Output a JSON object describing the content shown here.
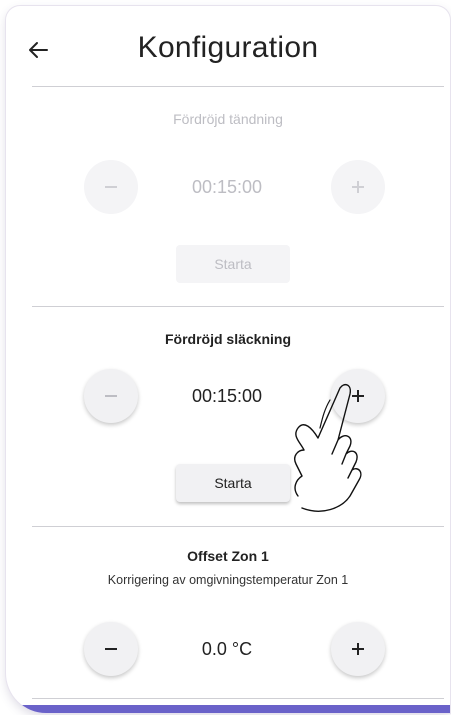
{
  "header": {
    "title": "Konfiguration",
    "back_icon": "arrow-left-icon"
  },
  "sections": [
    {
      "title": "Fördröjd tändning",
      "subtitle": "",
      "value": "00:15:00",
      "start_label": "Starta",
      "state": "disabled"
    },
    {
      "title": "Fördröjd släckning",
      "subtitle": "",
      "value": "00:15:00",
      "start_label": "Starta",
      "state": "enabled"
    },
    {
      "title": "Offset Zon 1",
      "subtitle": "Korrigering av omgivningstemperatur Zon 1",
      "value": "0.0 °C",
      "start_label": "",
      "state": "enabled"
    }
  ],
  "colors": {
    "accent": "#6a62c9",
    "divider": "#cfcfd4",
    "disabled_text": "#bdbdc3"
  }
}
